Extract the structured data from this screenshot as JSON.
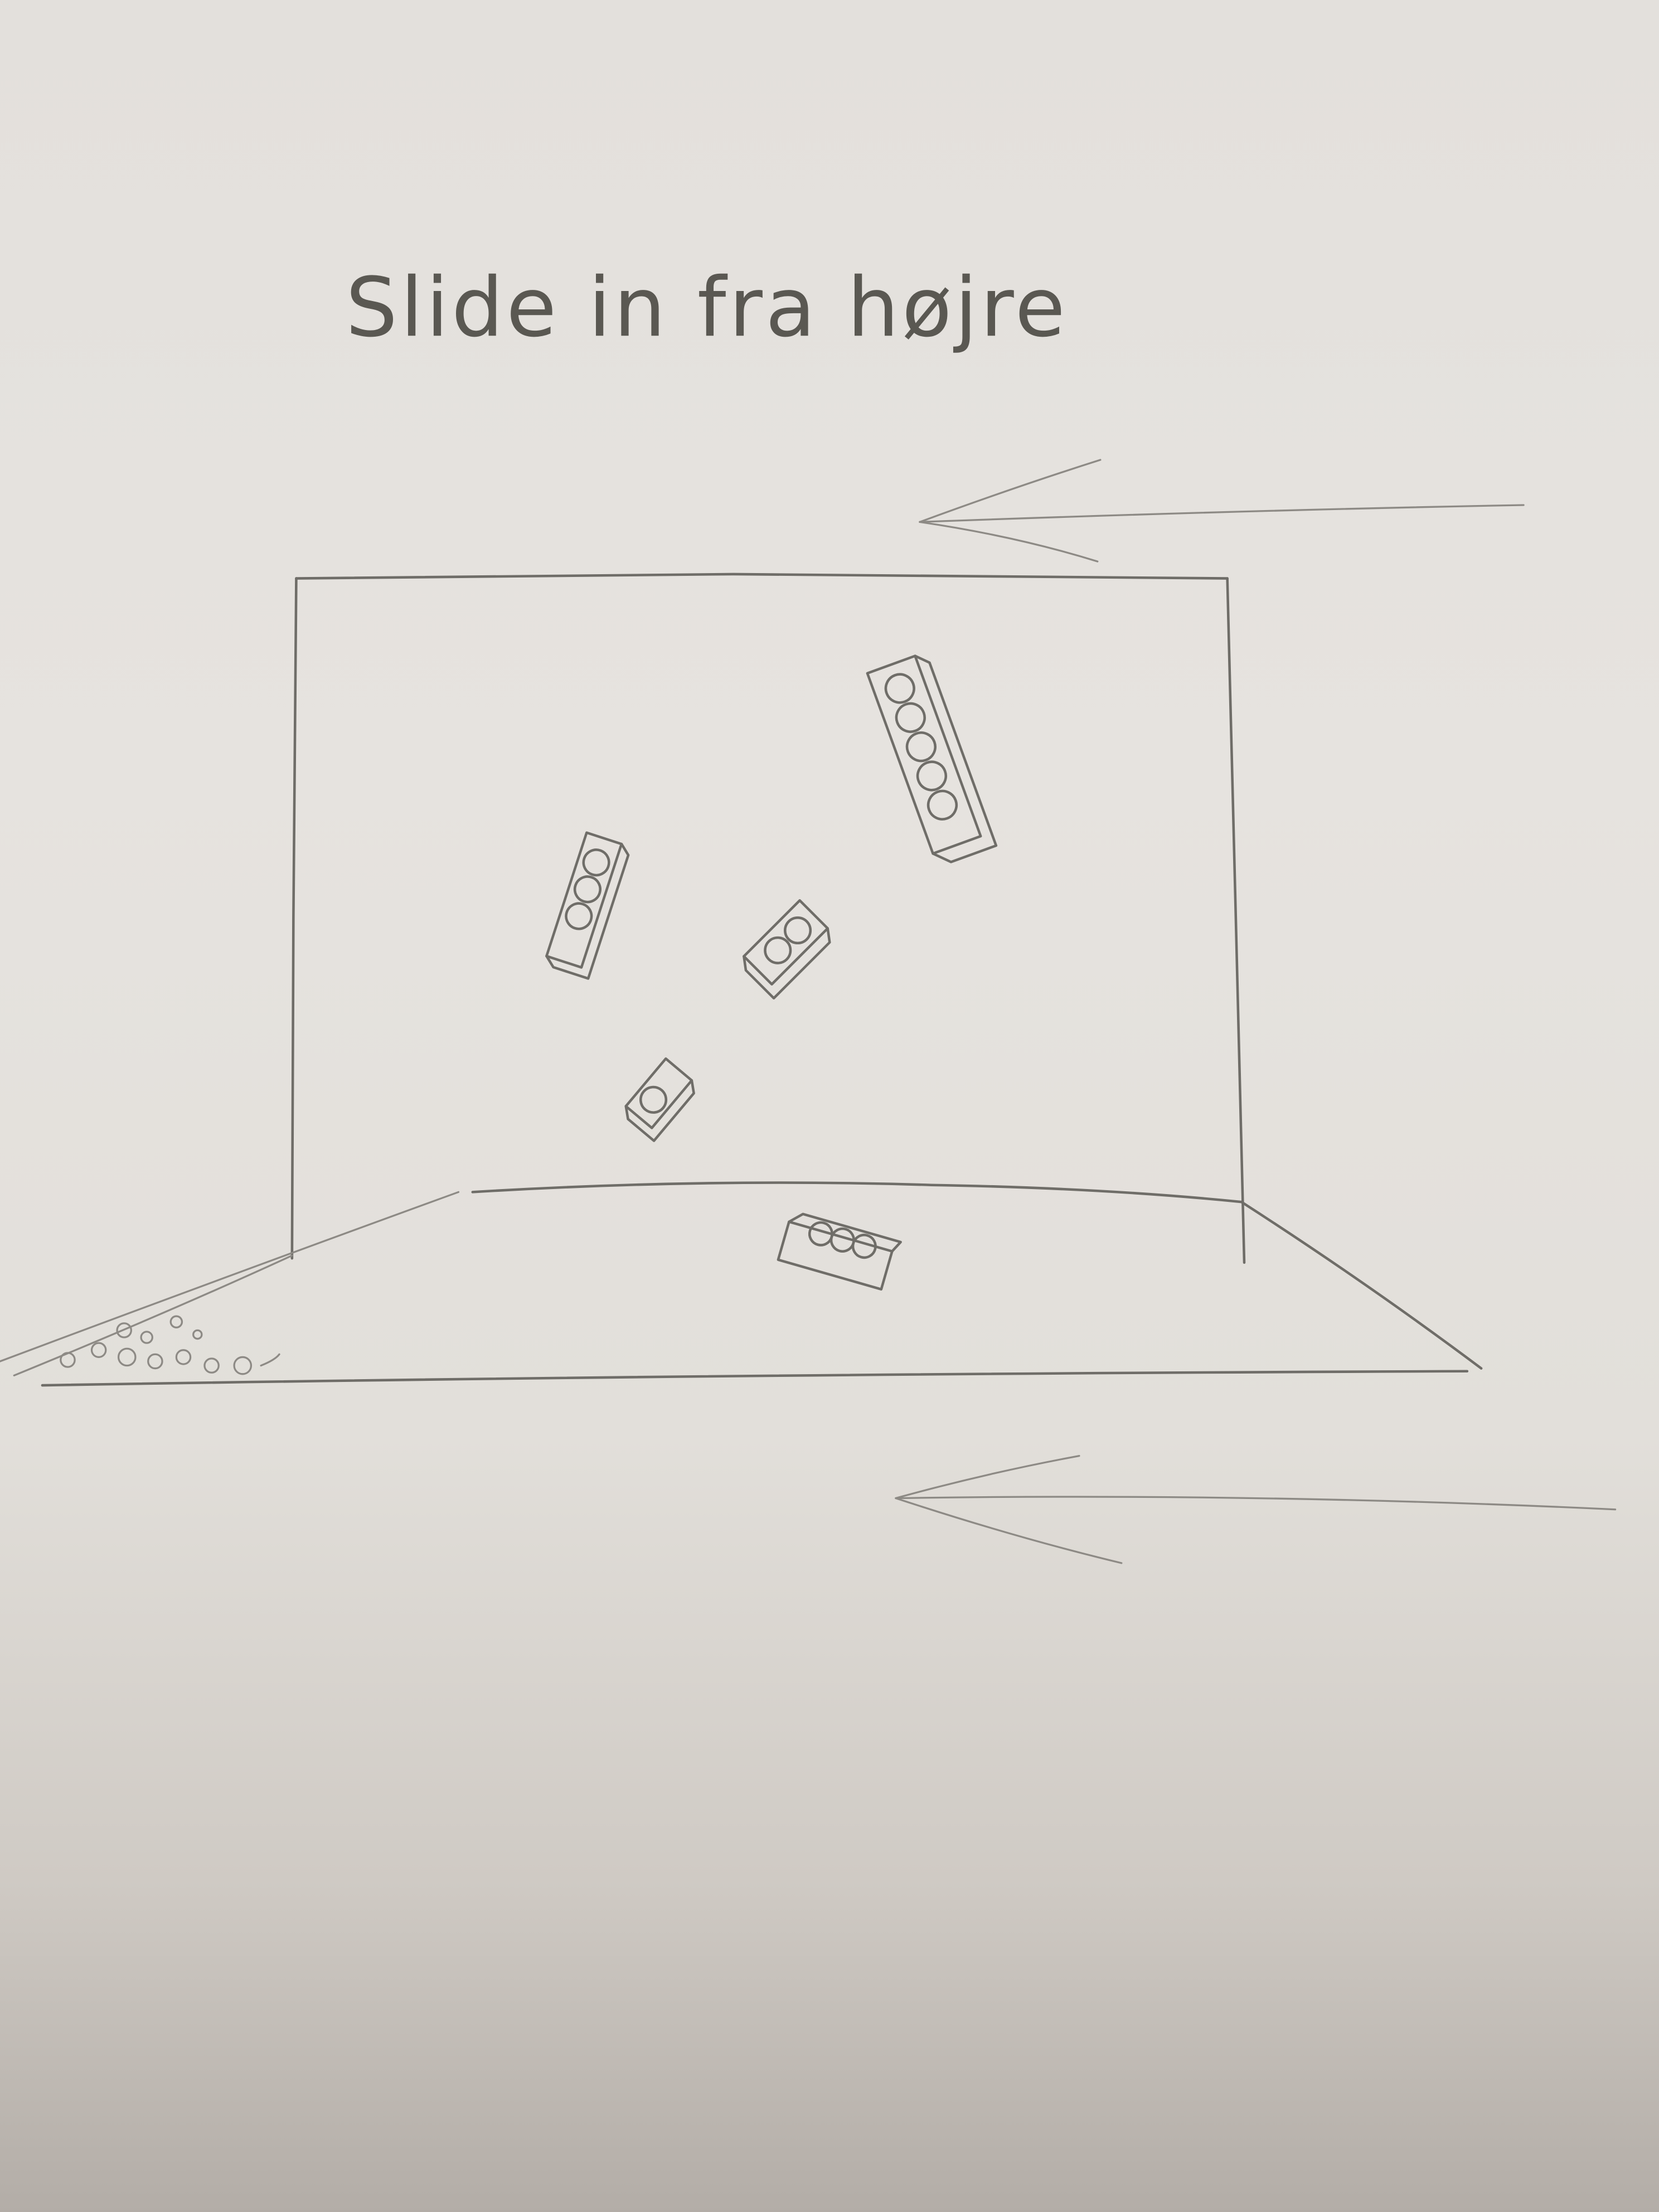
{
  "title": "Slide in fra højre",
  "annotations": {
    "top_arrow_direction": "left",
    "bottom_arrow_direction": "left"
  },
  "colors": {
    "paper": "#e3e0dc",
    "pencil": "#6f6d68"
  }
}
